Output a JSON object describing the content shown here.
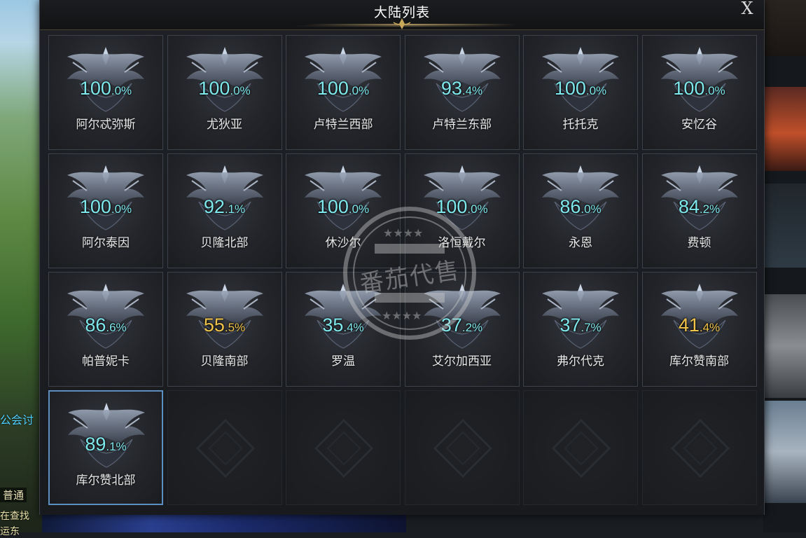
{
  "window": {
    "title": "大陆列表",
    "close_label": "X"
  },
  "background": {
    "left_texts": [
      "公会讨",
      "普通",
      "在查找",
      "运东"
    ]
  },
  "continents": [
    {
      "name": "阿尔忒弥斯",
      "pct_int": "100",
      "pct_dec": ".0%",
      "color": "cyan",
      "progress": 100.0
    },
    {
      "name": "尤狄亚",
      "pct_int": "100",
      "pct_dec": ".0%",
      "color": "cyan",
      "progress": 100.0
    },
    {
      "name": "卢特兰西部",
      "pct_int": "100",
      "pct_dec": ".0%",
      "color": "cyan",
      "progress": 100.0
    },
    {
      "name": "卢特兰东部",
      "pct_int": "93",
      "pct_dec": ".4%",
      "color": "cyan",
      "progress": 93.4
    },
    {
      "name": "托托克",
      "pct_int": "100",
      "pct_dec": ".0%",
      "color": "cyan",
      "progress": 100.0
    },
    {
      "name": "安忆谷",
      "pct_int": "100",
      "pct_dec": ".0%",
      "color": "cyan",
      "progress": 100.0
    },
    {
      "name": "阿尔泰因",
      "pct_int": "100",
      "pct_dec": ".0%",
      "color": "cyan",
      "progress": 100.0
    },
    {
      "name": "贝隆北部",
      "pct_int": "92",
      "pct_dec": ".1%",
      "color": "cyan",
      "progress": 92.1
    },
    {
      "name": "休沙尔",
      "pct_int": "100",
      "pct_dec": ".0%",
      "color": "cyan",
      "progress": 100.0
    },
    {
      "name": "洛恒戴尔",
      "pct_int": "100",
      "pct_dec": ".0%",
      "color": "cyan",
      "progress": 100.0
    },
    {
      "name": "永恩",
      "pct_int": "86",
      "pct_dec": ".0%",
      "color": "cyan",
      "progress": 86.0
    },
    {
      "name": "费顿",
      "pct_int": "84",
      "pct_dec": ".2%",
      "color": "cyan",
      "progress": 84.2
    },
    {
      "name": "帕普妮卡",
      "pct_int": "86",
      "pct_dec": ".6%",
      "color": "cyan",
      "progress": 86.6
    },
    {
      "name": "贝隆南部",
      "pct_int": "55",
      "pct_dec": ".5%",
      "color": "gold",
      "progress": 55.5
    },
    {
      "name": "罗温",
      "pct_int": "35",
      "pct_dec": ".4%",
      "color": "cyan",
      "progress": 35.4
    },
    {
      "name": "艾尔加西亚",
      "pct_int": "37",
      "pct_dec": ".2%",
      "color": "cyan",
      "progress": 37.2
    },
    {
      "name": "弗尔代克",
      "pct_int": "37",
      "pct_dec": ".7%",
      "color": "cyan",
      "progress": 37.7
    },
    {
      "name": "库尔赞南部",
      "pct_int": "41",
      "pct_dec": ".4%",
      "color": "gold",
      "progress": 41.4
    },
    {
      "name": "库尔赞北部",
      "pct_int": "89",
      "pct_dec": ".1%",
      "color": "cyan",
      "progress": 89.1,
      "selected": true
    }
  ],
  "empty_slots": 5,
  "watermark": {
    "text": "番茄代售"
  },
  "colors": {
    "cyan": "#7fe8ec",
    "gold": "#f0c44a",
    "selected_border": "#5c8fbf"
  }
}
